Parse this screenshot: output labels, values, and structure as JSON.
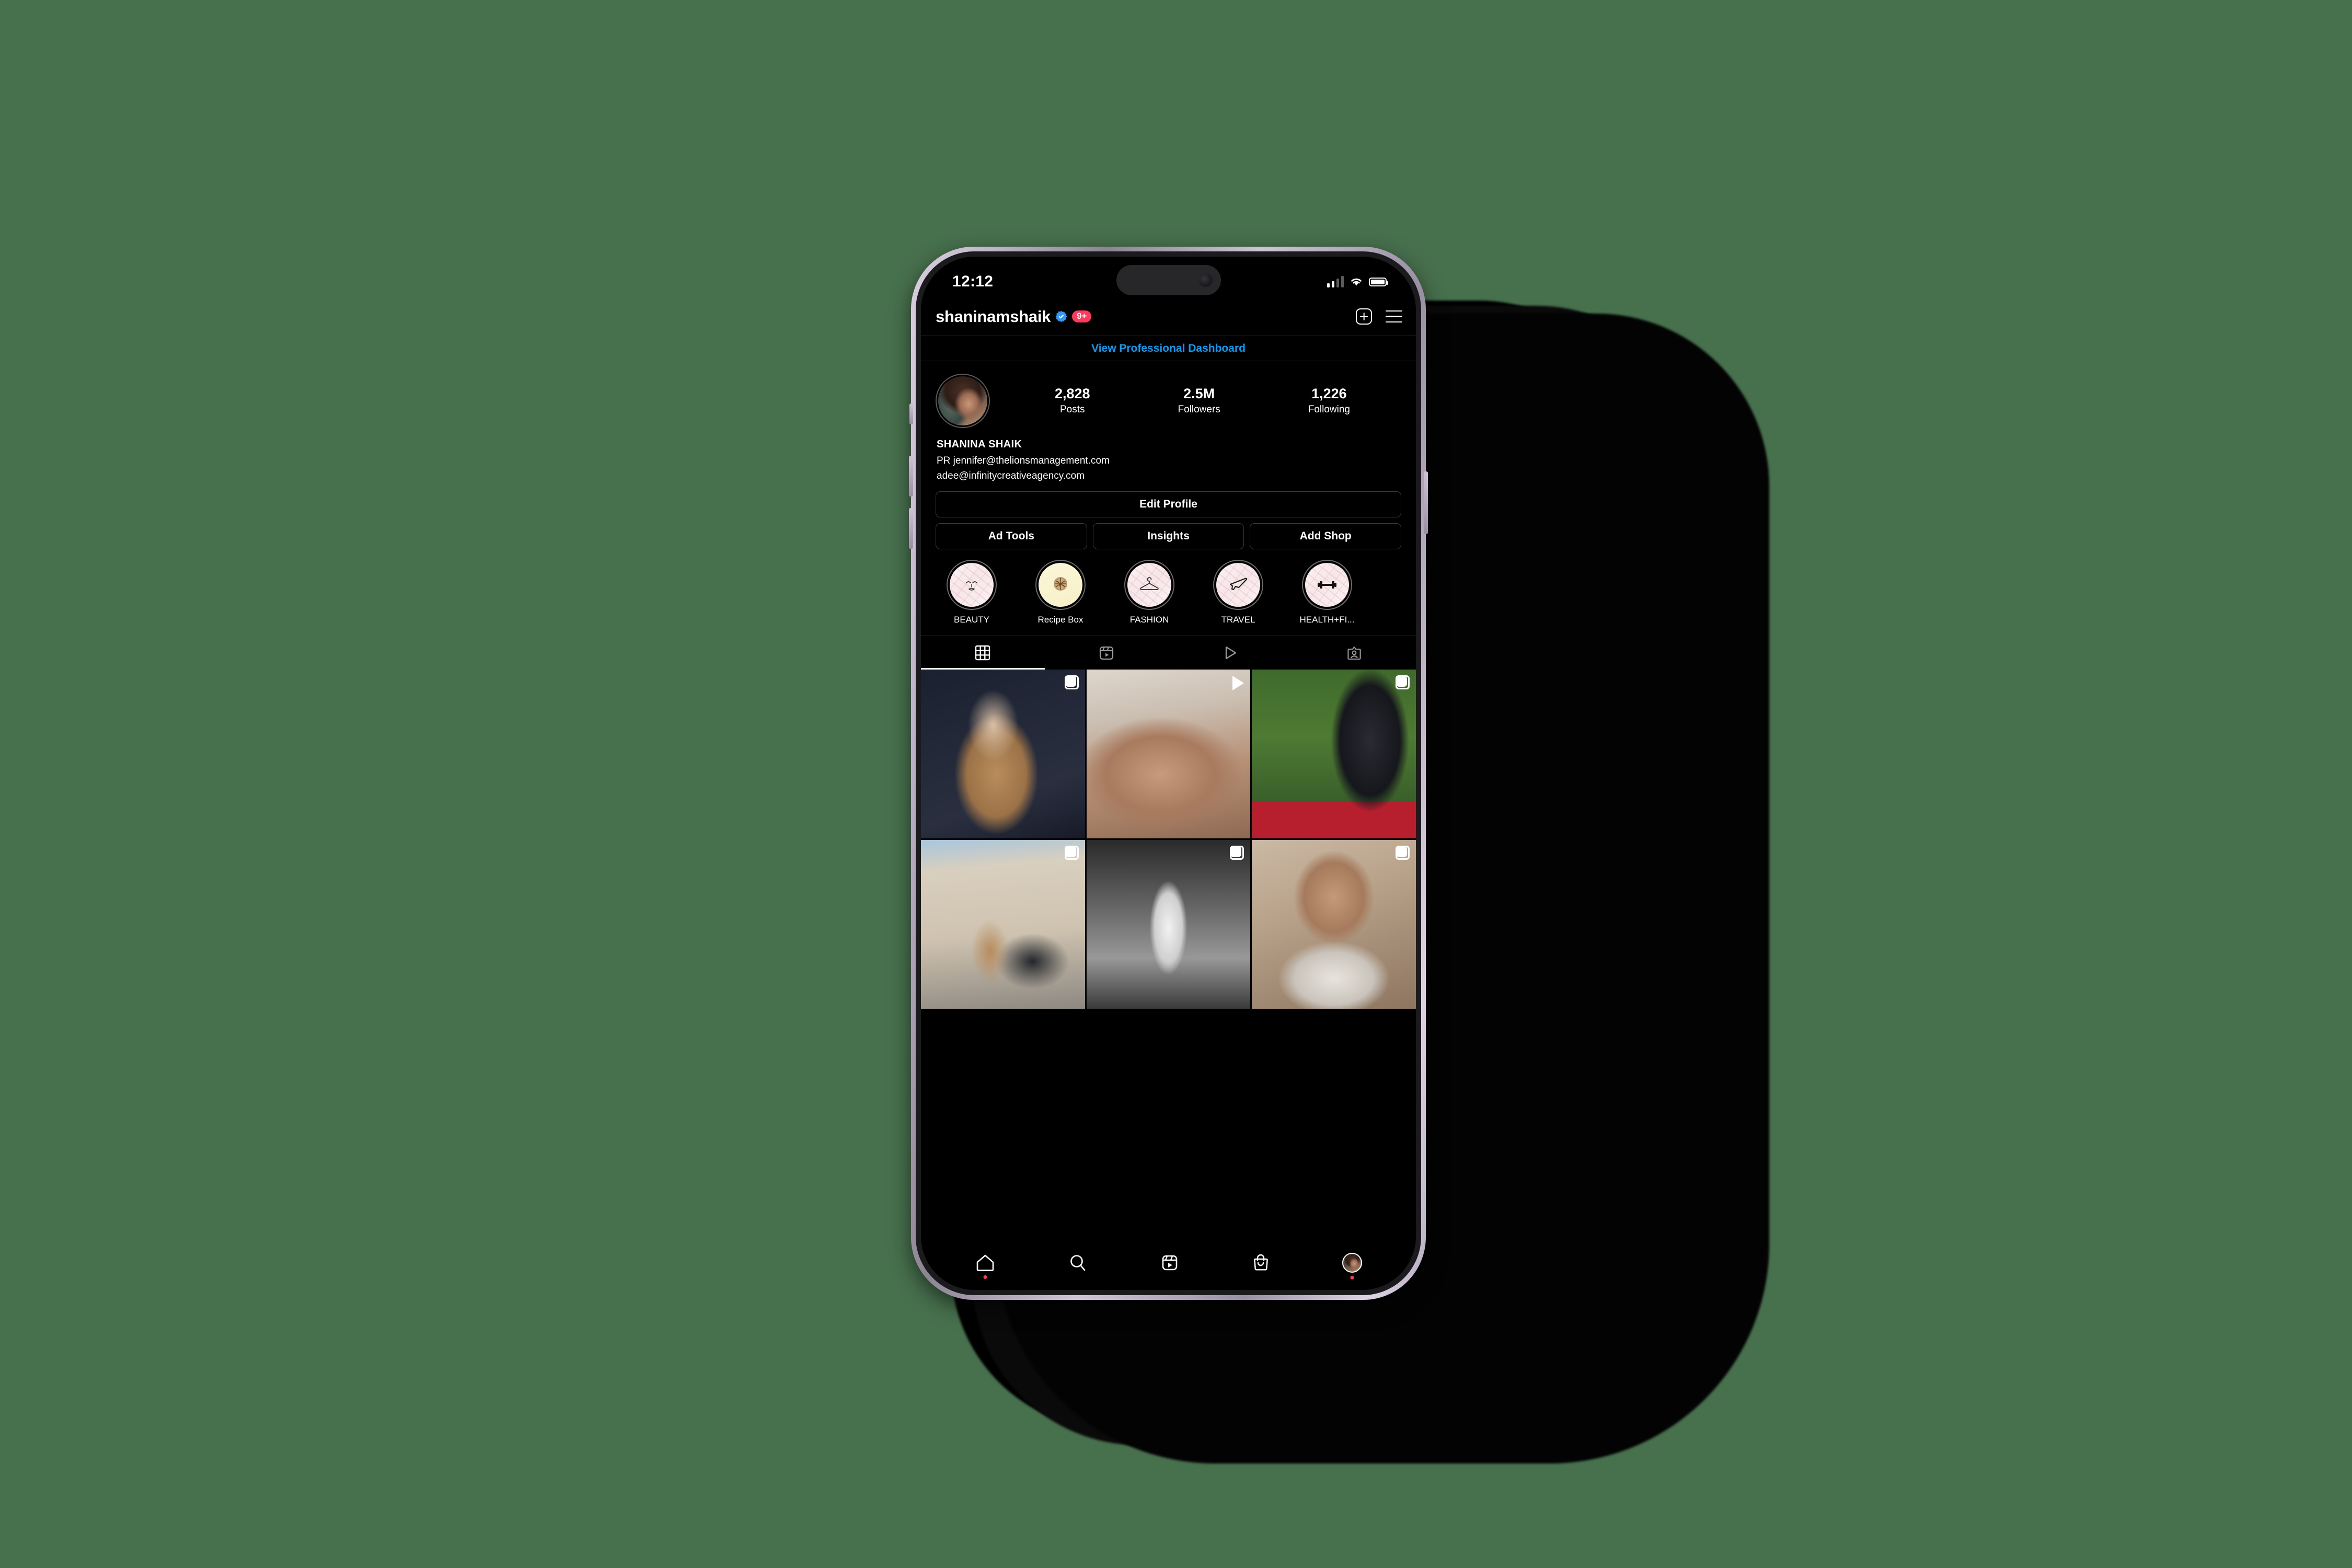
{
  "status_bar": {
    "time": "12:12",
    "cellular_icon": "signal-bars-icon",
    "wifi_icon": "wifi-icon",
    "battery_icon": "battery-full-icon"
  },
  "header": {
    "username": "shaninamshaik",
    "verified_icon": "verified-badge-icon",
    "notification_badge": "9+",
    "new_post_icon": "plus-square-icon",
    "menu_icon": "hamburger-menu-icon"
  },
  "professional_dashboard": {
    "label": "View Professional Dashboard",
    "color": "#0f9bf0"
  },
  "profile": {
    "avatar_name": "profile-avatar",
    "stats": [
      {
        "value": "2,828",
        "label": "Posts"
      },
      {
        "value": "2.5M",
        "label": "Followers"
      },
      {
        "value": "1,226",
        "label": "Following"
      }
    ],
    "display_name": "SHANINA SHAIK",
    "bio_lines": [
      "PR jennifer@thelionsmanagement.com",
      "adee@infinitycreativeagency.com"
    ]
  },
  "actions": {
    "edit_profile": "Edit Profile",
    "secondary": [
      "Ad Tools",
      "Insights",
      "Add Shop"
    ]
  },
  "highlights": [
    {
      "label": "BEAUTY",
      "icon": "face-icon",
      "cover": "pink-marble"
    },
    {
      "label": "Recipe Box",
      "icon": "pie-icon",
      "cover": "cream"
    },
    {
      "label": "FASHION",
      "icon": "hanger-icon",
      "cover": "pink-marble"
    },
    {
      "label": "TRAVEL",
      "icon": "airplane-icon",
      "cover": "pink-marble"
    },
    {
      "label": "HEALTH+FI...",
      "icon": "dumbbell-icon",
      "cover": "pink-marble"
    }
  ],
  "content_tabs": [
    {
      "name": "grid-tab",
      "icon": "grid-icon",
      "active": true
    },
    {
      "name": "reels-tab",
      "icon": "reels-icon",
      "active": false
    },
    {
      "name": "video-tab",
      "icon": "play-triangle-icon",
      "active": false
    },
    {
      "name": "tagged-tab",
      "icon": "tagged-person-icon",
      "active": false
    }
  ],
  "posts": [
    {
      "photo": "p1",
      "badge": "carousel-icon"
    },
    {
      "photo": "p2",
      "badge": "play-icon"
    },
    {
      "photo": "p3",
      "badge": "carousel-icon"
    },
    {
      "photo": "p4",
      "badge": "carousel-icon"
    },
    {
      "photo": "p5",
      "badge": "carousel-icon"
    },
    {
      "photo": "p6",
      "badge": "carousel-icon"
    }
  ],
  "bottom_nav": [
    {
      "name": "home",
      "icon": "home-icon",
      "dot": true
    },
    {
      "name": "search",
      "icon": "search-icon",
      "dot": false
    },
    {
      "name": "reels",
      "icon": "reels-icon",
      "dot": false
    },
    {
      "name": "shop",
      "icon": "shopping-bag-icon",
      "dot": false
    },
    {
      "name": "profile",
      "icon": "profile-avatar-icon",
      "dot": true
    }
  ],
  "colors": {
    "background": "#47704d",
    "app_bg": "#000000",
    "accent_blue": "#0f9bf0",
    "badge_red": "#fd3a5c",
    "verified_blue": "#3797f0"
  }
}
